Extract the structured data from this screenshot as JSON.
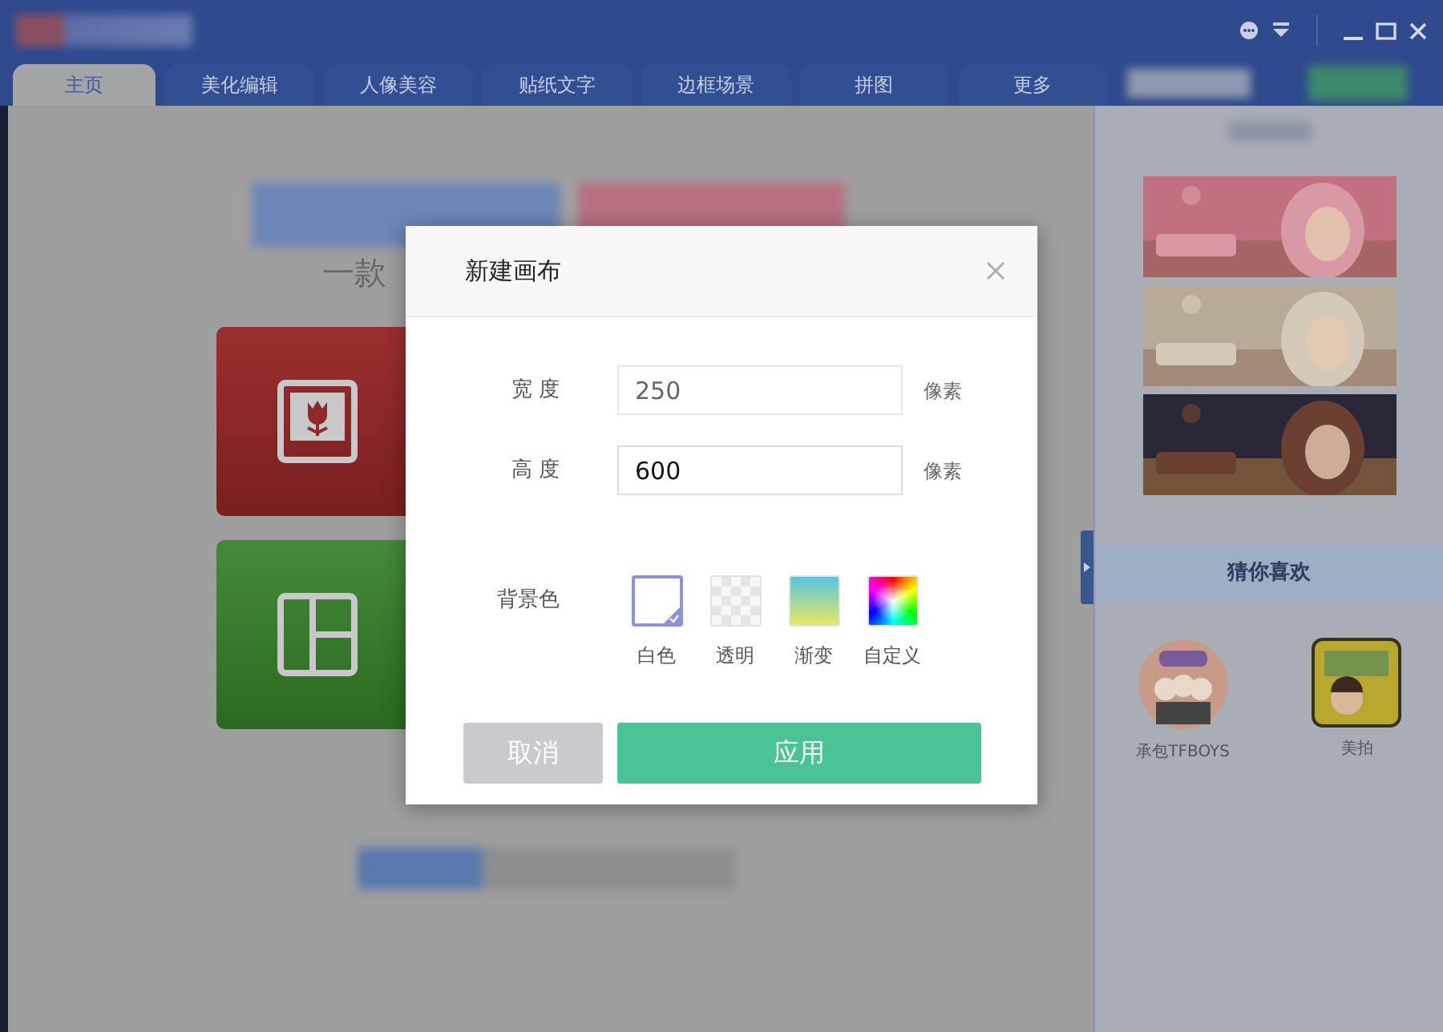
{
  "tabs": [
    {
      "label": "主页",
      "selected": true
    },
    {
      "label": "美化编辑",
      "selected": false
    },
    {
      "label": "人像美容",
      "selected": false
    },
    {
      "label": "贴纸文字",
      "selected": false
    },
    {
      "label": "边框场景",
      "selected": false
    },
    {
      "label": "拼图",
      "selected": false
    },
    {
      "label": "更多",
      "selected": false
    }
  ],
  "welcome": {
    "subtitle": "一款"
  },
  "dialog": {
    "title": "新建画布",
    "fields": [
      {
        "label": "宽 度",
        "value": "250",
        "unit": "像素",
        "focused": false
      },
      {
        "label": "高 度",
        "value": "600",
        "unit": "像素",
        "focused": true
      }
    ],
    "background": {
      "label": "背景色",
      "options": [
        {
          "label": "白色",
          "kind": "white",
          "selected": true
        },
        {
          "label": "透明",
          "kind": "transparent",
          "selected": false
        },
        {
          "label": "渐变",
          "kind": "gradient",
          "selected": false
        },
        {
          "label": "自定义",
          "kind": "custom",
          "selected": false
        }
      ]
    },
    "buttons": [
      {
        "label": "取消",
        "kind": "cancel"
      },
      {
        "label": "应用",
        "kind": "primary"
      }
    ]
  },
  "sidebar": {
    "recommend_title": "猜你喜欢",
    "apps": [
      {
        "label": "承包TFBOYS",
        "kind": "round"
      },
      {
        "label": "美拍",
        "kind": "square"
      }
    ]
  }
}
